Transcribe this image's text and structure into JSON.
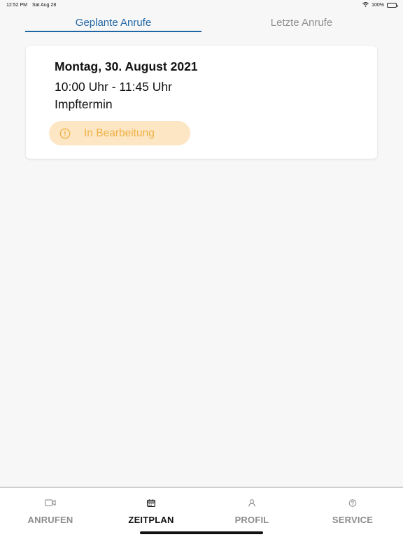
{
  "status_bar": {
    "time": "12:52 PM",
    "date": "Sat Aug 28",
    "battery": "100%",
    "icons": [
      "wifi-icon",
      "battery-icon"
    ]
  },
  "tabs": [
    {
      "label": "Geplante Anrufe",
      "active": true
    },
    {
      "label": "Letzte Anrufe",
      "active": false
    }
  ],
  "appointment": {
    "date": "Montag, 30. August 2021",
    "time": "10:00 Uhr - 11:45 Uhr",
    "type": "Impftermin",
    "status": "In Bearbeitung",
    "status_icon": "info-circle-icon"
  },
  "bottom_nav": [
    {
      "label": "ANRUFEN",
      "icon": "video-camera-icon",
      "active": false
    },
    {
      "label": "ZEITPLAN",
      "icon": "calendar-icon",
      "active": true
    },
    {
      "label": "PROFIL",
      "icon": "person-icon",
      "active": false
    },
    {
      "label": "SERVICE",
      "icon": "help-circle-icon",
      "active": false
    }
  ],
  "colors": {
    "accent": "#1f66a6",
    "status_bg": "#fde6c4",
    "status_text": "#eeb246",
    "inactive": "#8f8f8f"
  }
}
